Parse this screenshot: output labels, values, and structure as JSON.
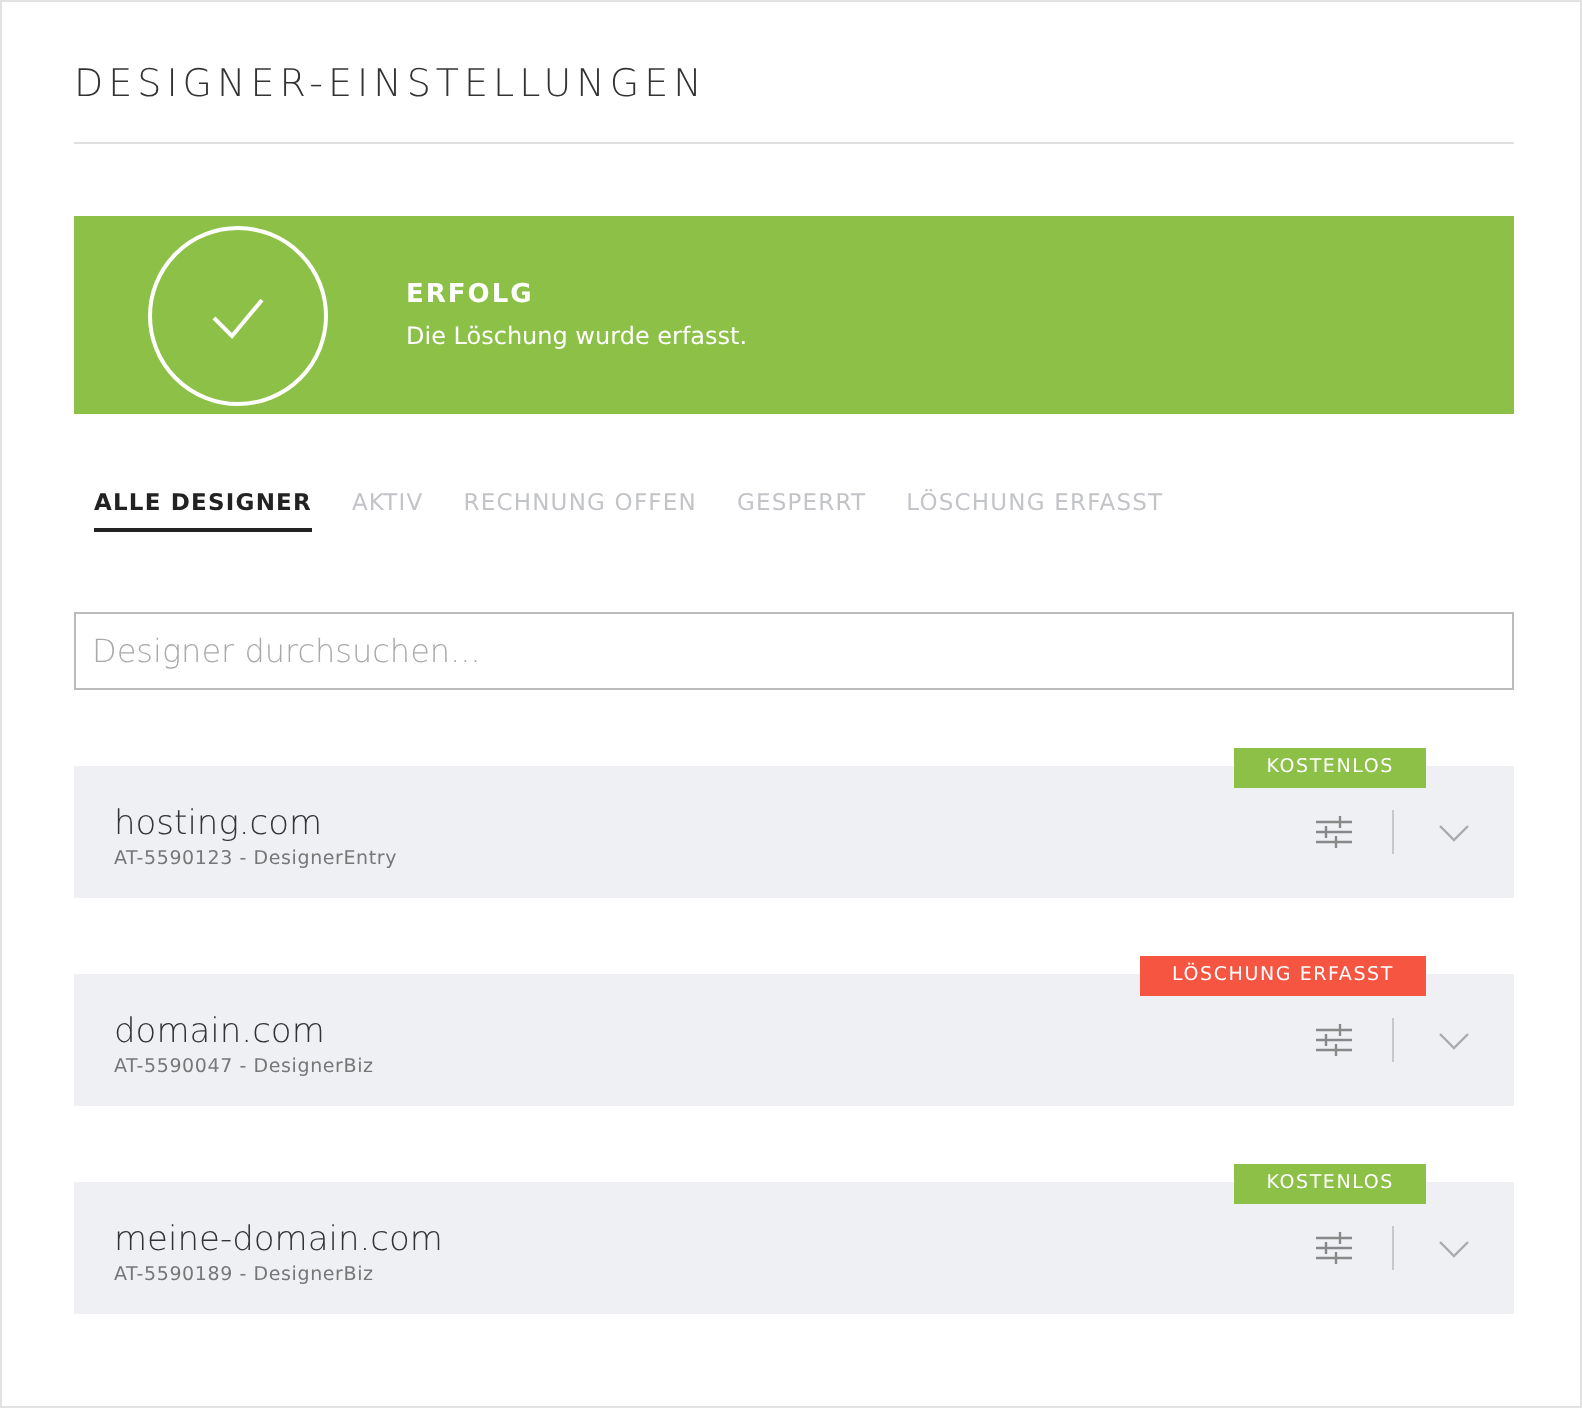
{
  "title": "DESIGNER-EINSTELLUNGEN",
  "alert": {
    "kind": "success",
    "title": "ERFOLG",
    "message": "Die Löschung wurde erfasst."
  },
  "tabs": [
    {
      "label": "ALLE DESIGNER",
      "selected": true
    },
    {
      "label": "AKTIV",
      "selected": false
    },
    {
      "label": "RECHNUNG OFFEN",
      "selected": false
    },
    {
      "label": "GESPERRT",
      "selected": false
    },
    {
      "label": "LÖSCHUNG ERFASST",
      "selected": false
    }
  ],
  "search": {
    "placeholder": "Designer durchsuchen..."
  },
  "designers": [
    {
      "domain": "hosting.com",
      "details": "AT-5590123 - DesignerEntry",
      "badge": "KOSTENLOS",
      "color": "#8dc047"
    },
    {
      "domain": "domain.com",
      "details": "AT-5590047 - DesignerBiz",
      "badge": "LÖSCHUNG ERFASST",
      "color": "#f55541"
    },
    {
      "domain": "meine-domain.com",
      "details": "AT-5590189 - DesignerBiz",
      "badge": "KOSTENLOS",
      "color": "#8dc047"
    }
  ]
}
